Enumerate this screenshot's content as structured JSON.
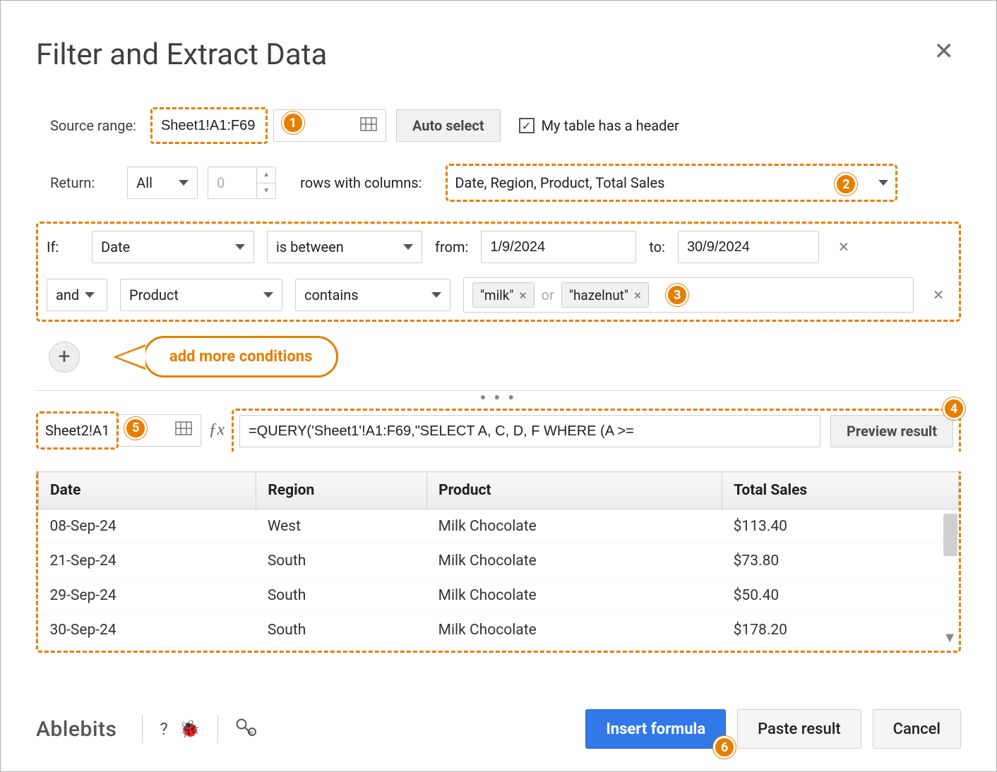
{
  "title": "Filter and Extract Data",
  "source": {
    "label": "Source range:",
    "value": "Sheet1!A1:F69",
    "auto_select": "Auto select",
    "header_check": "My table has a header"
  },
  "return_row": {
    "label": "Return:",
    "all": "All",
    "count": "0",
    "mid": "rows with columns:",
    "columns": "Date, Region, Product, Total Sales"
  },
  "cond1": {
    "if": "If:",
    "field": "Date",
    "op": "is between",
    "from_lbl": "from:",
    "from": "1/9/2024",
    "to_lbl": "to:",
    "to": "30/9/2024"
  },
  "cond2": {
    "join": "and",
    "field": "Product",
    "op": "contains",
    "chip1": "\"milk\"",
    "or": "or",
    "chip2": "\"hazelnut\""
  },
  "callout": "add more conditions",
  "dest": {
    "value": "Sheet2!A1"
  },
  "formula": "=QUERY('Sheet1'!A1:F69,\"SELECT A, C, D, F WHERE (A >=",
  "preview_btn": "Preview result",
  "table": {
    "headers": [
      "Date",
      "Region",
      "Product",
      "Total Sales"
    ],
    "rows": [
      [
        "08-Sep-24",
        "West",
        "Milk Chocolate",
        "$113.40"
      ],
      [
        "21-Sep-24",
        "South",
        "Milk Chocolate",
        "$73.80"
      ],
      [
        "29-Sep-24",
        "South",
        "Milk Chocolate",
        "$50.40"
      ],
      [
        "30-Sep-24",
        "South",
        "Milk Chocolate",
        "$178.20"
      ]
    ]
  },
  "footer": {
    "logo": "Ablebits",
    "insert": "Insert formula",
    "paste": "Paste result",
    "cancel": "Cancel"
  },
  "badges": {
    "b1": "1",
    "b2": "2",
    "b3": "3",
    "b4": "4",
    "b5": "5",
    "b6": "6"
  }
}
